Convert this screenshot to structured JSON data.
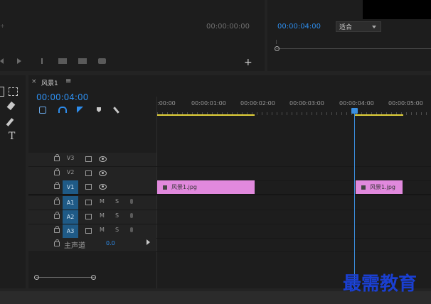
{
  "source_monitor": {
    "timecode": "00:00:00:00"
  },
  "program_monitor": {
    "timecode": "00:00:04:00",
    "fit_select": "适合"
  },
  "sequence": {
    "close": "×",
    "name": "风景1",
    "menu": "≡",
    "timecode": "00:00:04:00"
  },
  "ruler": {
    "labels": [
      ":00:00",
      "00:00:01:00",
      "00:00:02:00",
      "00:00:03:00",
      "00:00:04:00",
      "00:00:05:00"
    ]
  },
  "tracks": {
    "video": [
      {
        "label": "V3"
      },
      {
        "label": "V2"
      },
      {
        "label": "V1"
      }
    ],
    "audio": [
      {
        "label": "A1",
        "m": "M",
        "s": "S"
      },
      {
        "label": "A2",
        "m": "M",
        "s": "S"
      },
      {
        "label": "A3",
        "m": "M",
        "s": "S"
      }
    ],
    "master": {
      "label": "主声道",
      "value": "0.0"
    }
  },
  "clips": [
    {
      "name": "风景1.jpg"
    },
    {
      "name": "风景1.jpg"
    }
  ],
  "tools": {
    "type_tool": "T"
  },
  "watermark": "最需教育",
  "colors": {
    "accent": "#2d8ceb",
    "clip": "#e189dd",
    "playhead": "#3b8fe0",
    "work_area": "#e3d23a"
  }
}
